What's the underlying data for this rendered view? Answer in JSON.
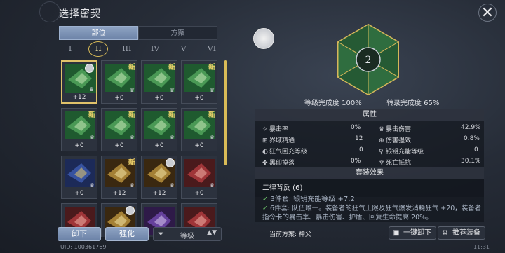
{
  "title": "选择密契",
  "tabs": [
    {
      "label": "部位",
      "active": true
    },
    {
      "label": "方案",
      "active": false
    }
  ],
  "slots": [
    {
      "label": "I",
      "active": false
    },
    {
      "label": "II",
      "active": true
    },
    {
      "label": "III",
      "active": false
    },
    {
      "label": "IV",
      "active": false
    },
    {
      "label": "V",
      "active": false
    },
    {
      "label": "VI",
      "active": false
    }
  ],
  "cards": [
    {
      "level": "+12",
      "new": "",
      "color": "green",
      "selected": true,
      "coin": true
    },
    {
      "level": "+0",
      "new": "新",
      "color": "green"
    },
    {
      "level": "+0",
      "new": "新",
      "color": "green"
    },
    {
      "level": "+0",
      "new": "新",
      "color": "green"
    },
    {
      "level": "+0",
      "new": "新",
      "color": "green"
    },
    {
      "level": "+0",
      "new": "新",
      "color": "green"
    },
    {
      "level": "+0",
      "new": "新",
      "color": "green"
    },
    {
      "level": "+0",
      "new": "新",
      "color": "green"
    },
    {
      "level": "+0",
      "new": "",
      "color": "blue"
    },
    {
      "level": "+12",
      "new": "新",
      "color": "gold"
    },
    {
      "level": "+12",
      "new": "",
      "color": "gold",
      "coin": true
    },
    {
      "level": "+0",
      "new": "",
      "color": "red"
    },
    {
      "level": "",
      "new": "",
      "color": "red"
    },
    {
      "level": "",
      "new": "",
      "color": "gold",
      "coin": true
    },
    {
      "level": "",
      "new": "",
      "color": "purple"
    },
    {
      "level": "",
      "new": "",
      "color": "red"
    }
  ],
  "buttons": {
    "unequip": "卸下",
    "enhance": "强化"
  },
  "filter": {
    "label": "等级"
  },
  "uid": "UID: 100361769",
  "time": "11:31",
  "completion": {
    "level": "等级完成度 100%",
    "transfer": "转录完成度 65%"
  },
  "attributes_header": "属性",
  "attributes": [
    {
      "name": "暴击率",
      "value": "0%"
    },
    {
      "name": "暴击伤害",
      "value": "42.9%"
    },
    {
      "name": "界域精通",
      "value": "12"
    },
    {
      "name": "伤害强效",
      "value": "0.8%"
    },
    {
      "name": "狂气回充等级",
      "value": "0"
    },
    {
      "name": "银钥充能等级",
      "value": "0"
    },
    {
      "name": "黑印掉落",
      "value": "0%"
    },
    {
      "name": "死亡抵抗",
      "value": "30.1%"
    }
  ],
  "set_header": "套装效果",
  "set": {
    "name": "二律背反 (6)",
    "piece2": "3件套: 银钥充能等级 +7.2",
    "piece6": "6件套: 队伍唯一。装备者的狂气上限及狂气爆发消耗狂气 +20，装备者指令卡的暴击率、暴击伤害、护盾、回复生命提高 20%。"
  },
  "plan": "当前方案: 神父",
  "right_buttons": {
    "unequip_all": "一键卸下",
    "recommend": "推荐装备"
  }
}
